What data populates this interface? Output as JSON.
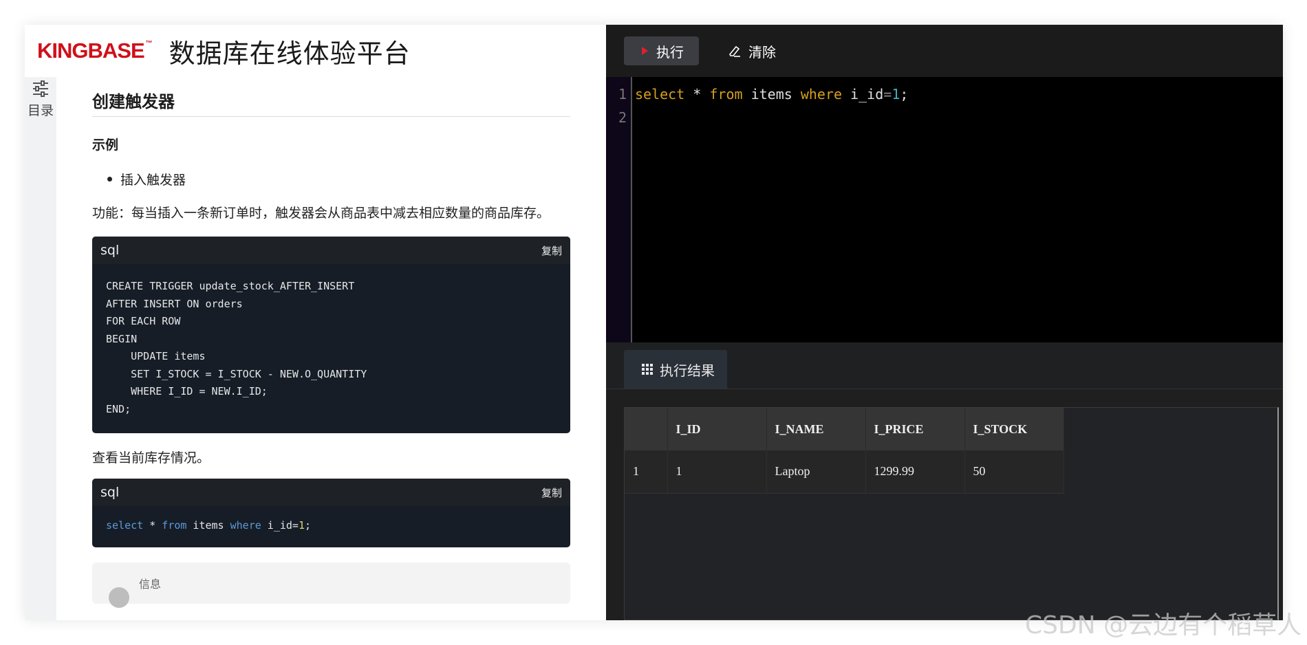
{
  "brand": {
    "logo_text": "KINGBASE",
    "logo_tm": "™",
    "site_title": "数据库在线体验平台",
    "logo_color": "#d0101a"
  },
  "toc": {
    "icon": "sliders-icon",
    "label": "目录"
  },
  "doc": {
    "heading": "创建触发器",
    "subheading": "示例",
    "bullet": "插入触发器",
    "desc": "功能：每当插入一条新订单时，触发器会从商品表中减去相应数量的商品库存。",
    "code1": {
      "lang": "sql",
      "copy": "复制",
      "lines": [
        "CREATE TRIGGER update_stock_AFTER_INSERT",
        "AFTER INSERT ON orders",
        "FOR EACH ROW",
        "BEGIN",
        "    UPDATE items",
        "    SET I_STOCK = I_STOCK - NEW.O_QUANTITY",
        "    WHERE I_ID = NEW.I_ID;",
        "END;"
      ]
    },
    "desc2": "查看当前库存情况。",
    "code2": {
      "lang": "sql",
      "copy": "复制",
      "parts": {
        "k1": "select",
        "t1": " * ",
        "k2": "from",
        "t2": " items ",
        "k3": "where",
        "t3": " i_id=",
        "n": "1",
        "t4": ";"
      }
    },
    "info_title": "信息"
  },
  "toolbar": {
    "run_label": "执行",
    "clear_label": "清除"
  },
  "editor": {
    "line_numbers": [
      "1",
      "2"
    ],
    "parts": {
      "k1": "select",
      "t1": " * ",
      "k2": "from",
      "t2": " items ",
      "k3": "where",
      "t3": " i_id",
      "op": "=",
      "n": "1",
      "t4": ";"
    }
  },
  "results": {
    "tab_label": "执行结果",
    "columns": [
      "",
      "I_ID",
      "I_NAME",
      "I_PRICE",
      "I_STOCK"
    ],
    "rows": [
      [
        "1",
        "1",
        "Laptop",
        "1299.99",
        "50"
      ]
    ]
  },
  "watermark": "CSDN @云边有个稻草人"
}
